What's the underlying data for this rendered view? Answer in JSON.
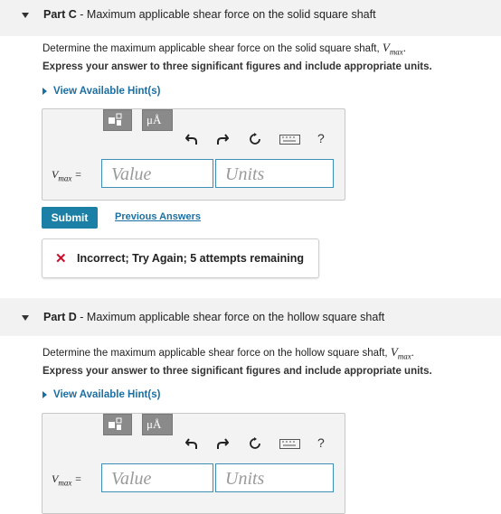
{
  "partC": {
    "label": "Part C",
    "title": " - Maximum applicable shear force on the solid square shaft",
    "question": "Determine the maximum applicable shear force on the solid square shaft, ",
    "var": "V",
    "var_sub": "max",
    "instruction": "Express your answer to three significant figures and include appropriate units.",
    "hint": "View Available Hint(s)",
    "value_placeholder": "Value",
    "units_placeholder": "Units",
    "submit": "Submit",
    "previous": "Previous Answers",
    "feedback": "Incorrect; Try Again; 5 attempts remaining",
    "mu_label": "μÅ",
    "help": "?"
  },
  "partD": {
    "label": "Part D",
    "title": " - Maximum applicable shear force on the hollow square shaft",
    "question": "Determine the maximum applicable shear force on the hollow square shaft, ",
    "var": "V",
    "var_sub": "max",
    "instruction": "Express your answer to three significant figures and include appropriate units.",
    "hint": "View Available Hint(s)",
    "value_placeholder": "Value",
    "units_placeholder": "Units",
    "mu_label": "μÅ",
    "help": "?"
  },
  "colors": {
    "link": "#1a6fa3",
    "submit": "#1c7fa5",
    "error": "#c8102e"
  }
}
